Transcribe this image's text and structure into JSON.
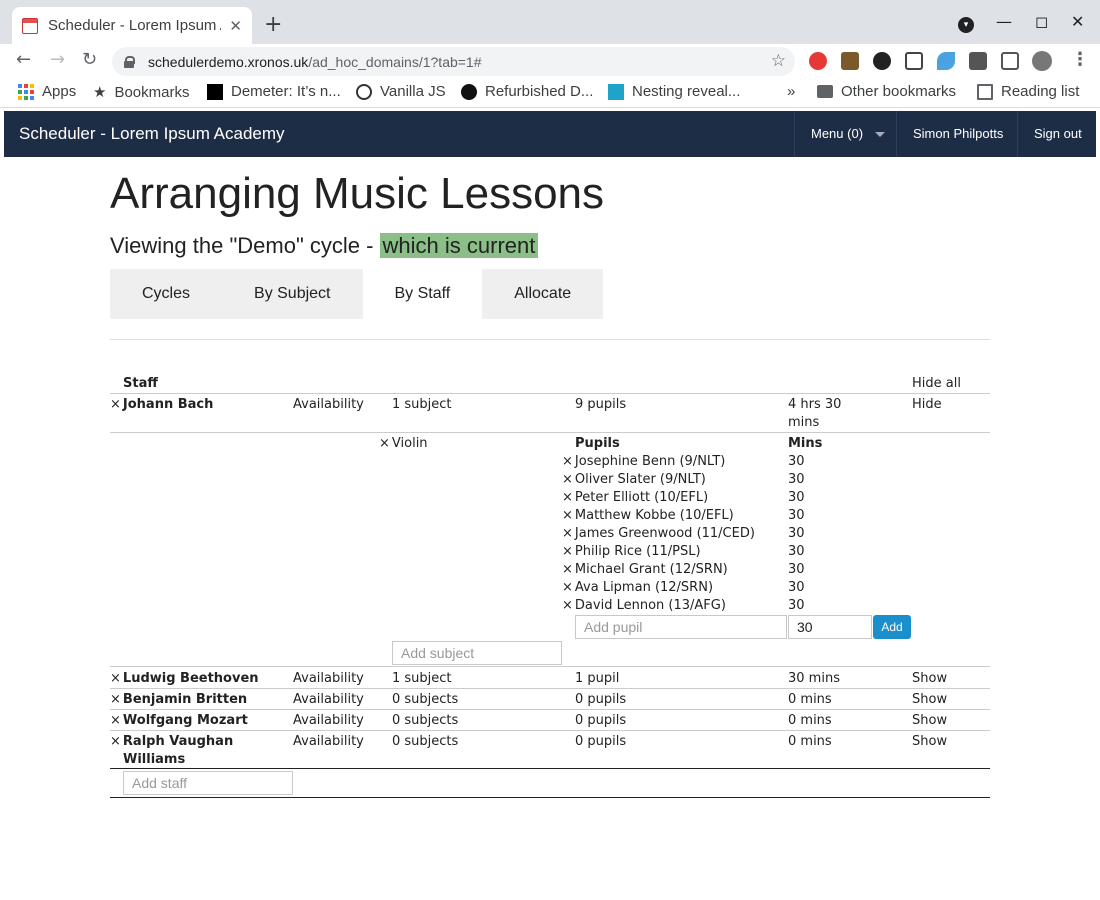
{
  "browser": {
    "tab_title": "Scheduler - Lorem Ipsum Academy",
    "url_host": "schedulerdemo.xronos.uk",
    "url_path": "/ad_hoc_domains/1?tab=1#",
    "bookmarks": [
      "Apps",
      "Bookmarks",
      "Demeter: It’s n...",
      "Vanilla JS",
      "Refurbished D...",
      "Nesting reveal..."
    ],
    "overflow": "»",
    "other_bookmarks": "Other bookmarks",
    "reading_list": "Reading list"
  },
  "header": {
    "brand": "Scheduler - Lorem Ipsum Academy",
    "menu": "Menu (0)",
    "user": "Simon Philpotts",
    "signout": "Sign out"
  },
  "page": {
    "title": "Arranging Music Lessons",
    "subtitle_prefix": "Viewing the \"Demo\" cycle - ",
    "subtitle_current": "which is current",
    "tabs": [
      "Cycles",
      "By Subject",
      "By Staff",
      "Allocate"
    ],
    "active_tab": "By Staff"
  },
  "table": {
    "staff_header": "Staff",
    "hide_all": "Hide all",
    "availability_label": "Availability",
    "expanded": {
      "name": "Johann Bach",
      "subjects": "1 subject",
      "pupils": "9 pupils",
      "time": "4 hrs 30",
      "time2": "mins",
      "toggle": "Hide",
      "subject": "Violin",
      "pupils_header": "Pupils",
      "mins_header": "Mins",
      "pupil_list": [
        {
          "name": "Josephine Benn (9/NLT)",
          "mins": "30"
        },
        {
          "name": "Oliver Slater (9/NLT)",
          "mins": "30"
        },
        {
          "name": "Peter Elliott (10/EFL)",
          "mins": "30"
        },
        {
          "name": "Matthew Kobbe (10/EFL)",
          "mins": "30"
        },
        {
          "name": "James Greenwood (11/CED)",
          "mins": "30"
        },
        {
          "name": "Philip Rice (11/PSL)",
          "mins": "30"
        },
        {
          "name": "Michael Grant (12/SRN)",
          "mins": "30"
        },
        {
          "name": "Ava Lipman (12/SRN)",
          "mins": "30"
        },
        {
          "name": "David Lennon (13/AFG)",
          "mins": "30"
        }
      ],
      "add_pupil_placeholder": "Add pupil",
      "add_mins_value": "30",
      "add_button": "Add",
      "add_subject_placeholder": "Add subject"
    },
    "rows": [
      {
        "name": "Ludwig Beethoven",
        "subjects": "1 subject",
        "pupils": "1 pupil",
        "time": "30 mins",
        "toggle": "Show"
      },
      {
        "name": "Benjamin Britten",
        "subjects": "0 subjects",
        "pupils": "0 pupils",
        "time": "0 mins",
        "toggle": "Show"
      },
      {
        "name": "Wolfgang Mozart",
        "subjects": "0 subjects",
        "pupils": "0 pupils",
        "time": "0 mins",
        "toggle": "Show"
      },
      {
        "name": "Ralph Vaughan",
        "name2": "Williams",
        "subjects": "0 subjects",
        "pupils": "0 pupils",
        "time": "0 mins",
        "toggle": "Show"
      }
    ],
    "add_staff_placeholder": "Add staff"
  }
}
